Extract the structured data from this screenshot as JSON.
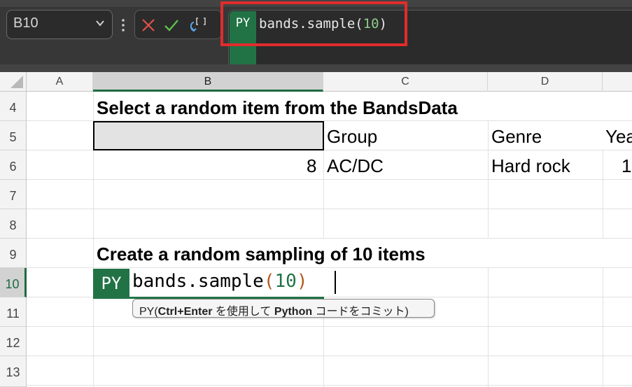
{
  "formula_bar": {
    "name_box": "B10",
    "py_badge": "PY",
    "formula_code": "bands.sample(",
    "formula_arg": "10",
    "formula_close": ")",
    "icons": [
      "chevron-down-icon",
      "vertical-dots-icon",
      "cancel-x-icon",
      "confirm-check-icon",
      "insert-function-icon"
    ]
  },
  "columns": [
    "A",
    "B",
    "C",
    "D",
    ""
  ],
  "rows": [
    "4",
    "5",
    "6",
    "7",
    "8",
    "9",
    "10",
    "11",
    "12",
    "13"
  ],
  "cells": {
    "b4": "Select a random item from the BandsData",
    "c5": "Group",
    "d5": "Genre",
    "e5": "Yea",
    "b6": "8",
    "c6": "AC/DC",
    "d6": "Hard rock",
    "e6": "1",
    "b9": "Create a random sampling of 10 items"
  },
  "editing_cell": {
    "py_badge": "PY",
    "code": "bands.sample",
    "open_paren": "(",
    "arg": "10",
    "close_paren": ")"
  },
  "tooltip": {
    "prefix": "PY(",
    "bold": "Ctrl+Enter",
    "middle": " を使用して ",
    "bold2": "Python",
    "suffix": " コードをコミット)"
  },
  "colors": {
    "accent_green": "#217346",
    "highlight_red": "#e12c2c",
    "formula_bg": "#373737"
  }
}
